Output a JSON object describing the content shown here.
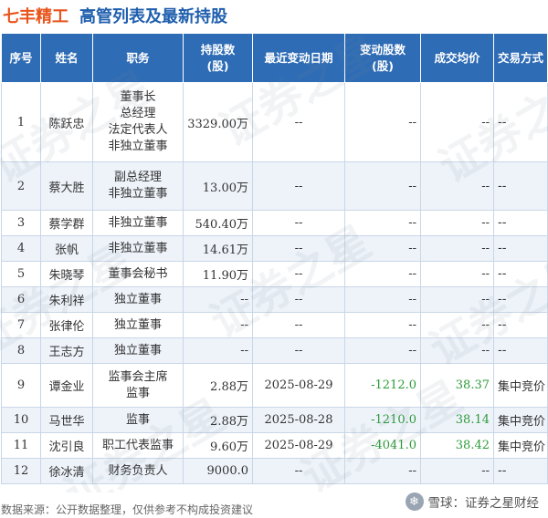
{
  "header": {
    "company": "七丰精工",
    "subtitle": "高管列表及最新持股"
  },
  "table": {
    "columns": [
      "序号",
      "姓名",
      "职务",
      "持股数\n(股)",
      "最近变动日期",
      "变动股数\n(股)",
      "成交均价",
      "交易方式"
    ],
    "rows": [
      {
        "no": "1",
        "name": "陈跃忠",
        "title": "董事长\n总经理\n法定代表人\n非独立董事",
        "shares": "3329.00万",
        "date": "--",
        "change": "--",
        "price": "--",
        "method": "--"
      },
      {
        "no": "2",
        "name": "蔡大胜",
        "title": "副总经理\n非独立董事",
        "shares": "13.00万",
        "date": "--",
        "change": "--",
        "price": "--",
        "method": "--"
      },
      {
        "no": "3",
        "name": "蔡学群",
        "title": "非独立董事",
        "shares": "540.40万",
        "date": "--",
        "change": "--",
        "price": "--",
        "method": "--"
      },
      {
        "no": "4",
        "name": "张帆",
        "title": "非独立董事",
        "shares": "14.61万",
        "date": "--",
        "change": "--",
        "price": "--",
        "method": "--"
      },
      {
        "no": "5",
        "name": "朱晓琴",
        "title": "董事会秘书",
        "shares": "11.90万",
        "date": "--",
        "change": "--",
        "price": "--",
        "method": "--"
      },
      {
        "no": "6",
        "name": "朱利祥",
        "title": "独立董事",
        "shares": "--",
        "date": "--",
        "change": "--",
        "price": "--",
        "method": "--"
      },
      {
        "no": "7",
        "name": "张律伦",
        "title": "独立董事",
        "shares": "--",
        "date": "--",
        "change": "--",
        "price": "--",
        "method": "--"
      },
      {
        "no": "8",
        "name": "王志方",
        "title": "独立董事",
        "shares": "--",
        "date": "--",
        "change": "--",
        "price": "--",
        "method": "--"
      },
      {
        "no": "9",
        "name": "谭金业",
        "title": "监事会主席\n监事",
        "shares": "2.88万",
        "date": "2025-08-29",
        "change": "-1212.0",
        "price": "38.37",
        "method": "集中竞价"
      },
      {
        "no": "10",
        "name": "马世华",
        "title": "监事",
        "shares": "2.88万",
        "date": "2025-08-28",
        "change": "-1210.0",
        "price": "38.14",
        "method": "集中竞价"
      },
      {
        "no": "11",
        "name": "沈引良",
        "title": "职工代表监事",
        "shares": "9.60万",
        "date": "2025-08-29",
        "change": "-4041.0",
        "price": "38.42",
        "method": "集中竞价"
      },
      {
        "no": "12",
        "name": "徐冰清",
        "title": "财务负责人",
        "shares": "9000.0",
        "date": "--",
        "change": "--",
        "price": "--",
        "method": "--"
      }
    ]
  },
  "footer": {
    "source": "数据来源：公开数据整理，仅供参考不构成投资建议",
    "brand": "雪球：证券之星财经"
  },
  "watermark": "证券之星",
  "colors": {
    "company": "#e8541c",
    "subtitle": "#1f5fae",
    "header_bg": "#2e6cb5",
    "green": "#2d9b3a"
  }
}
